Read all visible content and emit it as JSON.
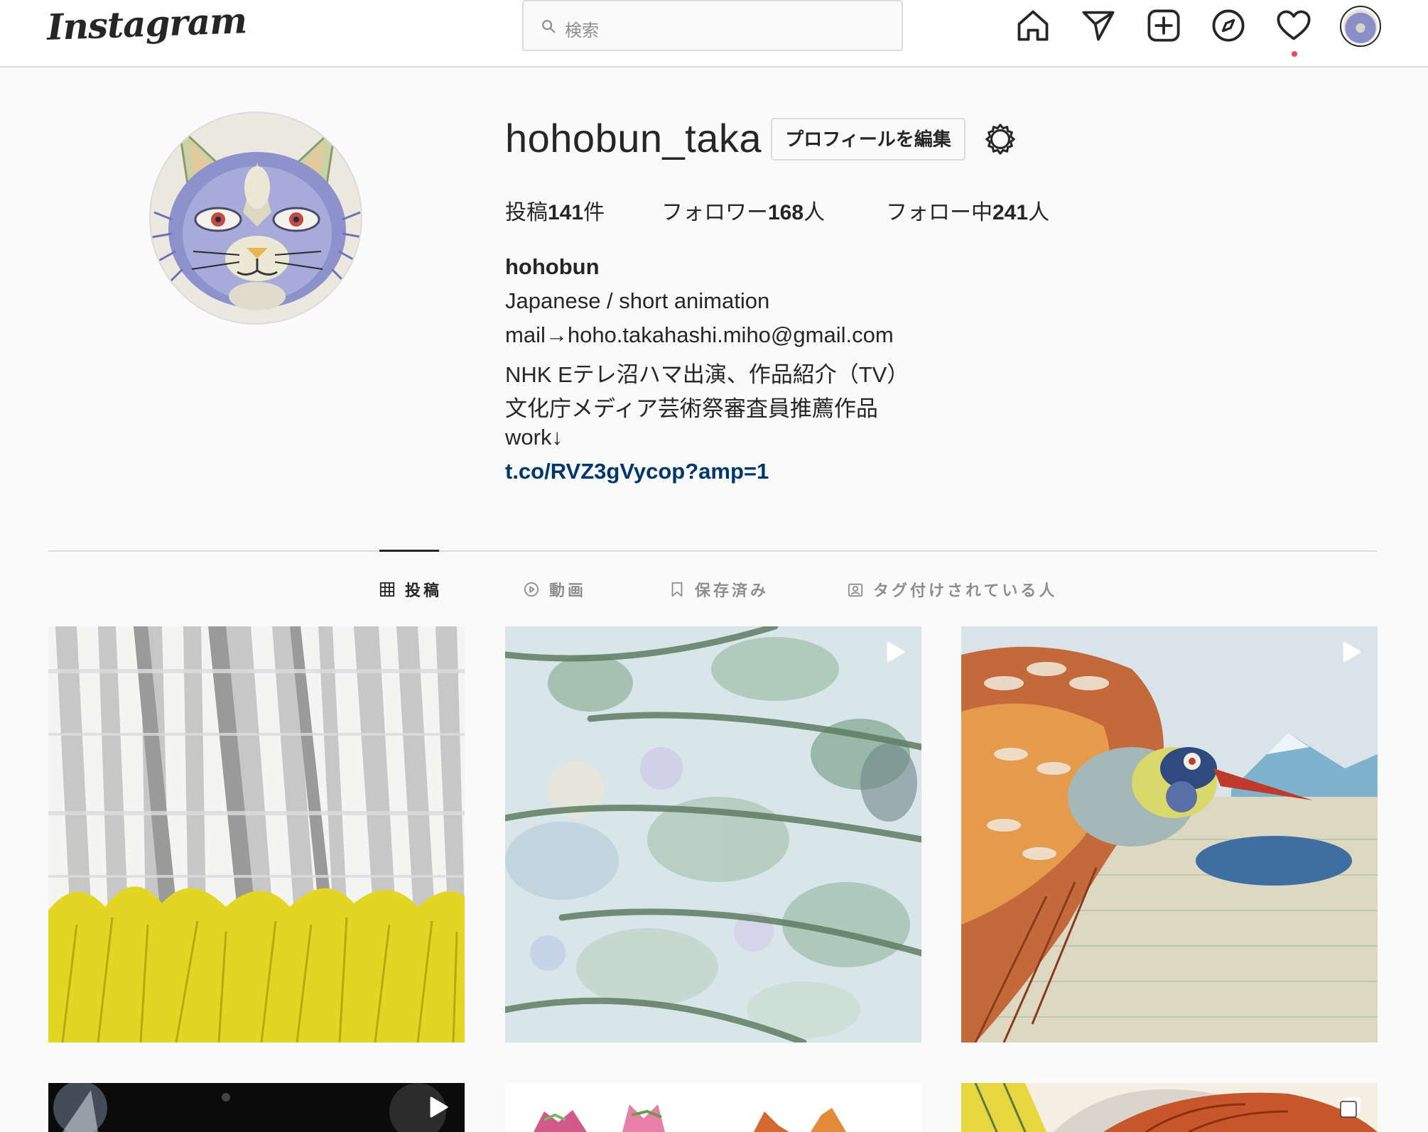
{
  "nav": {
    "logo": "Instagram",
    "search_placeholder": "検索",
    "icons": [
      "home-icon",
      "direct-message-icon",
      "new-post-icon",
      "explore-icon",
      "activity-heart-icon",
      "profile-avatar"
    ]
  },
  "profile": {
    "username": "hohobun_taka",
    "edit_button": "プロフィールを編集",
    "stats": {
      "posts_label": "投稿",
      "posts_count": "141",
      "posts_unit": "件",
      "followers_label": "フォロワー",
      "followers_count": "168",
      "followers_unit": "人",
      "following_label": "フォロー中",
      "following_count": "241",
      "following_unit": "人"
    },
    "bio": {
      "name": "hohobun",
      "line1": "Japanese / short animation",
      "line2": "mail→hoho.takahashi.miho@gmail.com",
      "line3": "NHK Eテレ沼ハマ出演、作品紹介（TV）",
      "line4": "文化庁メディア芸術祭審査員推薦作品",
      "line5": "work↓",
      "link": "t.co/RVZ3gVycop?amp=1"
    }
  },
  "tabs": [
    {
      "label": "投稿",
      "icon": "grid-icon",
      "active": true
    },
    {
      "label": "動画",
      "icon": "video-play-icon",
      "active": false
    },
    {
      "label": "保存済み",
      "icon": "bookmark-icon",
      "active": false
    },
    {
      "label": "タグ付けされている人",
      "icon": "tagged-icon",
      "active": false
    }
  ],
  "posts": [
    {
      "type": "image",
      "subject": "birch forest with yellow grass"
    },
    {
      "type": "video",
      "subject": "leaves and branches"
    },
    {
      "type": "video",
      "subject": "flying bird over meadow"
    },
    {
      "type": "video",
      "subject": "dark night scene"
    },
    {
      "type": "image",
      "subject": "ornamental birds"
    },
    {
      "type": "carousel",
      "subject": "orange bird wing"
    }
  ],
  "colors": {
    "link": "#00376b",
    "notification_dot": "#ed4956",
    "border": "#dbdbdb",
    "text_secondary": "#8e8e8e"
  }
}
